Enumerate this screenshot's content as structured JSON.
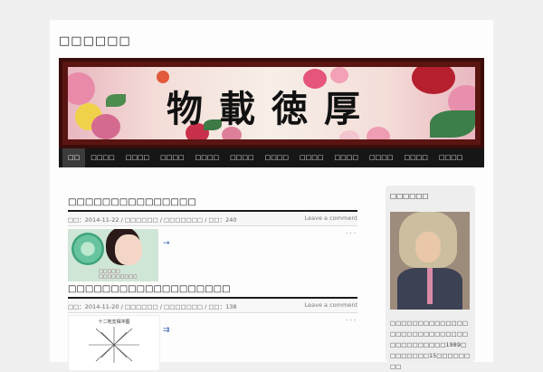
{
  "site": {
    "title": "□□□□□□"
  },
  "banner": {
    "text": "物載徳厚"
  },
  "nav": {
    "items": [
      "□□",
      "□□□□",
      "□□□□",
      "□□□□",
      "□□□□",
      "□□□□",
      "□□□□",
      "□□□□",
      "□□□□",
      "□□□□",
      "□□□□",
      "□□□□"
    ]
  },
  "posts": [
    {
      "title": "□□□□□□□□□□□□□□□",
      "meta": "□□：2014-11-22 / □□□□□□ / □□□□□□□ / □□：240",
      "comment_link": "Leave a comment",
      "thumb_caption": "□□□□□\n□□□□□□□□□",
      "arrow": "→",
      "dots": "· · ·"
    },
    {
      "title": "□□□□□□□□□□□□□□□□□□□",
      "meta": "□□：2014-11-20 / □□□□□□ / □□□□□□□ / □□：138",
      "comment_link": "Leave a comment",
      "thumb_caption": "十二地支相冲图",
      "arrow": "⇉",
      "dots": "· · ·"
    }
  ],
  "sidebar": {
    "widget_title": "□□□□□□",
    "bio": "□□□□□□□□□□□□□□□□□□□□□□□□□□□□□□□□□□□□□□1989□□□□□□□□15□□□□□□□□"
  },
  "colors": {
    "nav_bg": "#161616",
    "title_rule": "#1a1a1a",
    "banner_frame": "#5a1512",
    "link": "#2e5fb7"
  }
}
